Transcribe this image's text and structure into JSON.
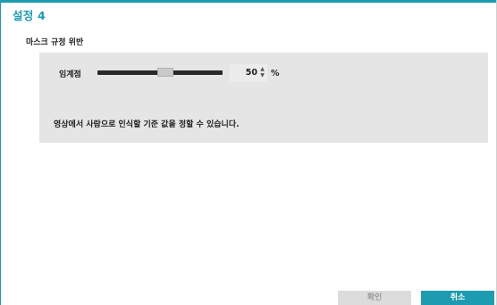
{
  "dialog": {
    "title": "설정 4"
  },
  "section": {
    "label": "마스크 규정 위반"
  },
  "threshold": {
    "label": "임계점",
    "value": "50",
    "unit": "%",
    "slider_fraction": 0.5,
    "spin_up_icon": "spin-up-icon",
    "spin_down_icon": "spin-down-icon"
  },
  "description": "영상에서 사람으로 인식할 기준 값을 정할 수 있습니다.",
  "buttons": {
    "ok_label": "확인",
    "cancel_label": "취소"
  },
  "colors": {
    "accent": "#1d9bb0",
    "panel": "#e5e5e5",
    "disabled_button": "#dcdcdc"
  }
}
